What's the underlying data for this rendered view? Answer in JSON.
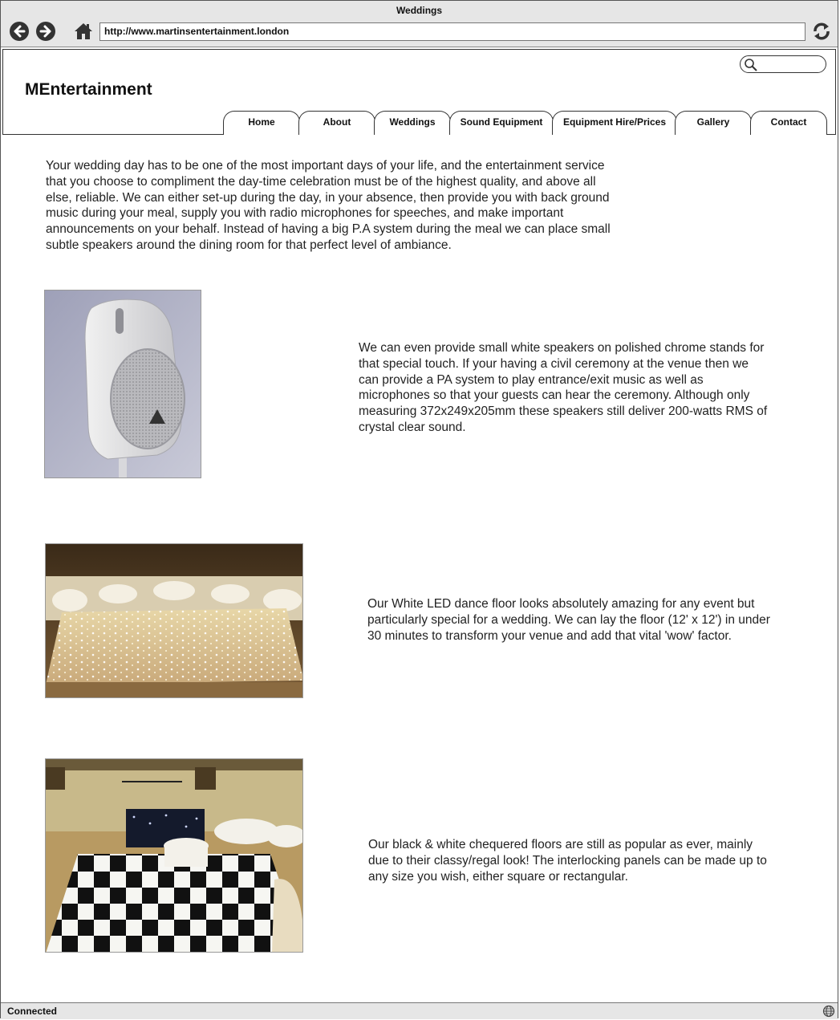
{
  "window": {
    "title": "Weddings"
  },
  "browser": {
    "url": "http://www.martinsentertainment.london",
    "status": "Connected"
  },
  "site": {
    "logo": "MEntertainment",
    "search": {
      "placeholder": ""
    },
    "nav": [
      {
        "label": "Home"
      },
      {
        "label": "About"
      },
      {
        "label": "Weddings"
      },
      {
        "label": "Sound Equipment"
      },
      {
        "label": "Equipment Hire/Prices"
      },
      {
        "label": "Gallery"
      },
      {
        "label": "Contact"
      }
    ]
  },
  "content": {
    "intro": "Your wedding day has to be one of the most important days of your life, and the entertainment service that you choose to compliment the day-time celebration must be of the highest quality, and above all else, reliable. We can either set-up during the day, in your absence, then provide you with back ground music during your meal, supply you with radio microphones for speeches, and make important announcements on your behalf. Instead of having a big P.A system during the meal we can place small subtle speakers around the dining room for that perfect level of ambiance.",
    "sections": [
      {
        "image": "white-speaker-photo",
        "text": "We can even provide small white speakers on polished chrome stands for that special touch. If your having a civil ceremony at the venue then we can provide a PA system to play entrance/exit music as well as microphones so that your guests can hear the ceremony. Although only measuring 372x249x205mm these speakers still deliver 200-watts RMS of crystal clear sound."
      },
      {
        "image": "led-dance-floor-photo",
        "text": "Our White LED dance floor looks absolutely amazing for any event but particularly special for a wedding. We can lay the floor (12' x 12') in under 30 minutes to transform your venue and add that vital 'wow' factor."
      },
      {
        "image": "chequered-floor-photo",
        "text": "Our black & white chequered floors are still as popular as ever, mainly due to their classy/regal look! The interlocking panels can be made up to any size you wish, either square or rectangular."
      }
    ]
  },
  "icons": {
    "back": "arrow-left-icon",
    "forward": "arrow-right-icon",
    "home": "home-icon",
    "reload": "reload-icon",
    "search": "search-icon",
    "globe": "globe-icon"
  }
}
